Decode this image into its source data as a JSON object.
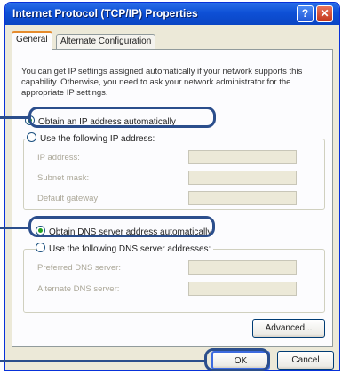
{
  "window": {
    "title": "Internet Protocol (TCP/IP) Properties",
    "help_glyph": "?",
    "close_glyph": "✕"
  },
  "tabs": [
    {
      "label": "General",
      "active": true
    },
    {
      "label": "Alternate Configuration",
      "active": false
    }
  ],
  "description": "You can get IP settings assigned automatically if your network supports this capability. Otherwise, you need to ask your network administrator for the appropriate IP settings.",
  "ip": {
    "auto_label": "Obtain an IP address automatically",
    "auto_selected": true,
    "manual_label": "Use the following IP address:",
    "fields": [
      {
        "label": "IP address:",
        "value": ""
      },
      {
        "label": "Subnet mask:",
        "value": ""
      },
      {
        "label": "Default gateway:",
        "value": ""
      }
    ]
  },
  "dns": {
    "auto_label": "Obtain DNS server address automatically",
    "auto_selected": true,
    "manual_label": "Use the following DNS server addresses:",
    "fields": [
      {
        "label": "Preferred DNS server:",
        "value": ""
      },
      {
        "label": "Alternate DNS server:",
        "value": ""
      }
    ]
  },
  "buttons": {
    "advanced": "Advanced...",
    "ok": "OK",
    "cancel": "Cancel"
  },
  "colors": {
    "titlebar": "#0a45c4",
    "callout": "#2b4e8c",
    "radio_checked": "#21a121"
  }
}
